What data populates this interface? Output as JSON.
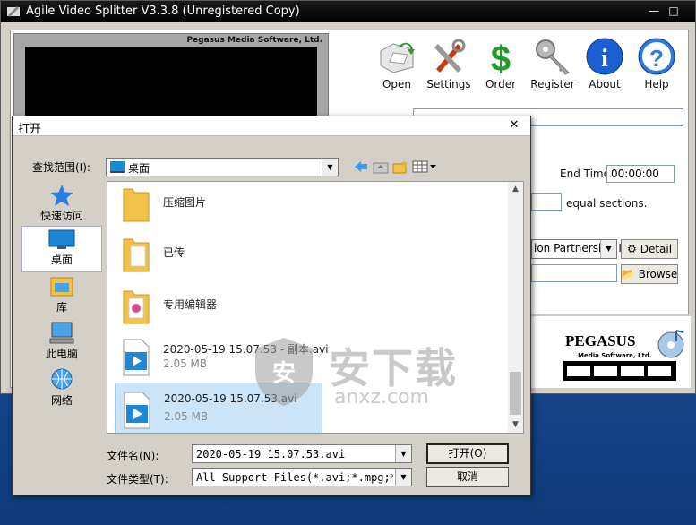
{
  "app": {
    "title": "Agile Video Splitter V3.3.8 (Unregistered Copy)",
    "preview_brand": "Pegasus Media Software, Ltd.",
    "toolbar": [
      {
        "label": "Open",
        "icon": "open-folder-icon"
      },
      {
        "label": "Settings",
        "icon": "tools-icon"
      },
      {
        "label": "Order",
        "icon": "dollar-icon"
      },
      {
        "label": "Register",
        "icon": "key-icon"
      },
      {
        "label": "About",
        "icon": "info-icon"
      },
      {
        "label": "Help",
        "icon": "help-icon"
      }
    ],
    "end_time_label": "End Time:",
    "end_time_value": "00:00:00",
    "equal_sections_label": "equal sections.",
    "profile_value": "ion Partnership I",
    "detail_button": "Detail",
    "browse_button": "Browse",
    "logo_name": "PEGASUS",
    "logo_sub": "Media Software, Ltd."
  },
  "dialog": {
    "title": "打开",
    "look_in_label": "查找范围(I):",
    "look_in_value": "桌面",
    "places": [
      {
        "label": "快速访问",
        "icon": "star-icon",
        "selected": false
      },
      {
        "label": "桌面",
        "icon": "desktop-icon",
        "selected": true
      },
      {
        "label": "库",
        "icon": "library-icon",
        "selected": false
      },
      {
        "label": "此电脑",
        "icon": "computer-icon",
        "selected": false
      },
      {
        "label": "网络",
        "icon": "network-icon",
        "selected": false
      }
    ],
    "files": [
      {
        "name": "压缩图片",
        "size": "",
        "type": "folder"
      },
      {
        "name": "已传",
        "size": "",
        "type": "folder"
      },
      {
        "name": "专用编辑器",
        "size": "",
        "type": "folder"
      },
      {
        "name": "2020-05-19 15.07.53 - 副本.avi",
        "size": "2.05 MB",
        "type": "video"
      },
      {
        "name": "2020-05-19 15.07.53.avi",
        "size": "2.05 MB",
        "type": "video"
      }
    ],
    "filename_label": "文件名(N):",
    "filename_value": "2020-05-19 15.07.53.avi",
    "filetype_label": "文件类型(T):",
    "filetype_value": "All Support Files(*.avi;*.mpg;*.mpeg;",
    "open_button": "打开(O)",
    "cancel_button": "取消"
  },
  "watermark": {
    "cn": "安下载",
    "en": "anxz.com"
  },
  "colors": {
    "selection": "#cce4f7",
    "folder": "#f0c24a",
    "video": "#1e88d6",
    "accent": "#1a5fb4"
  }
}
